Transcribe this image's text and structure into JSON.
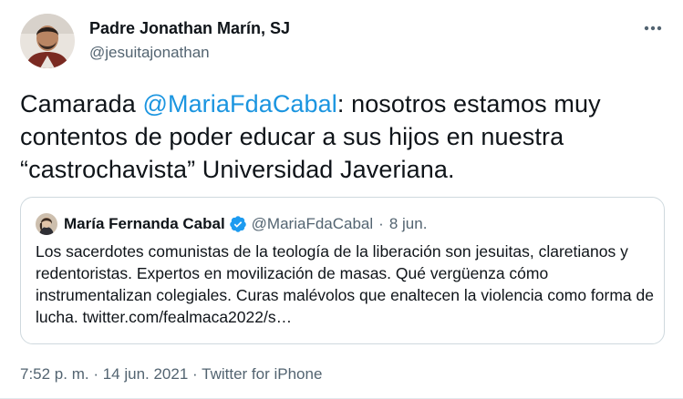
{
  "author": {
    "name": "Padre Jonathan Marín, SJ",
    "handle": "@jesuitajonathan"
  },
  "tweet": {
    "text_before": "Camarada ",
    "mention": "@MariaFdaCabal",
    "text_after": ": nosotros estamos muy contentos de poder educar a sus hijos en nuestra “castrochavista” Universidad Javeriana."
  },
  "quoted_tweet": {
    "name": "María Fernanda Cabal",
    "handle": "@MariaFdaCabal",
    "separator": "·",
    "date": "8 jun.",
    "text": "Los sacerdotes comunistas de la teología de la liberación son jesuitas, claretianos y redentoristas. Expertos en movilización de masas. Qué vergüenza cómo instrumentalizan colegiales. Curas malévolos que enaltecen la violencia como forma de lucha. twitter.com/fealmaca2022/s…"
  },
  "meta": {
    "timestamp": "7:52 p. m. · 14 jun. 2021",
    "separator": "·",
    "source": "Twitter for iPhone"
  },
  "icons": {
    "more": "more-horizontal-icon",
    "verified": "verified-badge-icon"
  },
  "colors": {
    "link": "#1b95e0",
    "verified": "#1d9bf0",
    "secondary_text": "#536471",
    "border": "#cfd9de"
  }
}
